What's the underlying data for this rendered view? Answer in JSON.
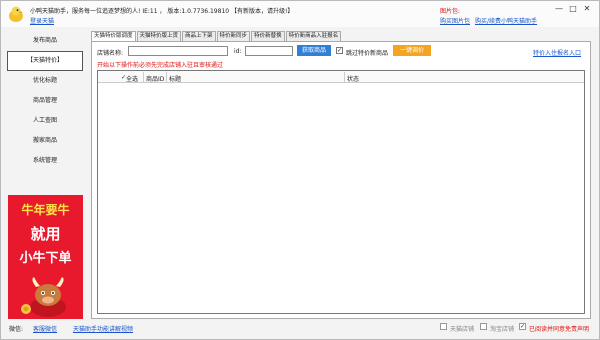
{
  "header": {
    "title": "小鸭天猫助手，服务每一位追逐梦想的人! IE:11 ， 版本:1.0.7736.19810 【有新版本，请升级!】",
    "login_link": "登录天猫",
    "package_label": "图片包:",
    "package_link": "购买图片包",
    "promo_link": "购买/续费小鸭天猫助手"
  },
  "window_controls": {
    "minimize": "—",
    "maximize": "□",
    "close": "✕"
  },
  "sidebar": {
    "items": [
      {
        "label": "发布商品"
      },
      {
        "label": "【天猫特价】"
      },
      {
        "label": "优化标题"
      },
      {
        "label": "商品管理"
      },
      {
        "label": "人工查图"
      },
      {
        "label": "搬家商品"
      },
      {
        "label": "系统管理"
      }
    ],
    "active_index": 1
  },
  "ad": {
    "line1": "牛年要牛",
    "line2": "就用",
    "line3": "小牛下单"
  },
  "tabs": [
    {
      "label": "天猫特价版调度"
    },
    {
      "label": "天猫特价版上货"
    },
    {
      "label": "商品上下架"
    },
    {
      "label": "特价新同步"
    },
    {
      "label": "特价新替换"
    },
    {
      "label": "特价新商品入驻报名"
    }
  ],
  "toolbar": {
    "shop_label": "店铺名称:",
    "shop_value": "",
    "id_label": "id:",
    "id_value": "",
    "fetch_button": "获取商品",
    "skip_checkbox_label": "跳过特价新商品",
    "skip_checked": true,
    "one_click_button": "一键调价",
    "warning": "开始以下操作前必须先完成店铺入驻且审核通过",
    "entry_link": "特价入住报名入口"
  },
  "table": {
    "select_all_label": "全选",
    "columns": [
      "商品ID",
      "标题",
      "状态"
    ],
    "rows": []
  },
  "footer": {
    "wechat_label": "微信:",
    "wechat_link": "客服微信",
    "video_link": "天猫助手功能讲解视频",
    "opt1_label": "天猫店铺",
    "opt2_label": "淘宝店铺",
    "agreement_label": "已阅读并同意免责声明",
    "agreement_checked": true
  },
  "colors": {
    "accent_blue": "#2f7fd8",
    "accent_orange": "#f4a41e",
    "warning_red": "#dd1111",
    "link_blue": "#1a56c9",
    "ad_red": "#e8192c"
  }
}
